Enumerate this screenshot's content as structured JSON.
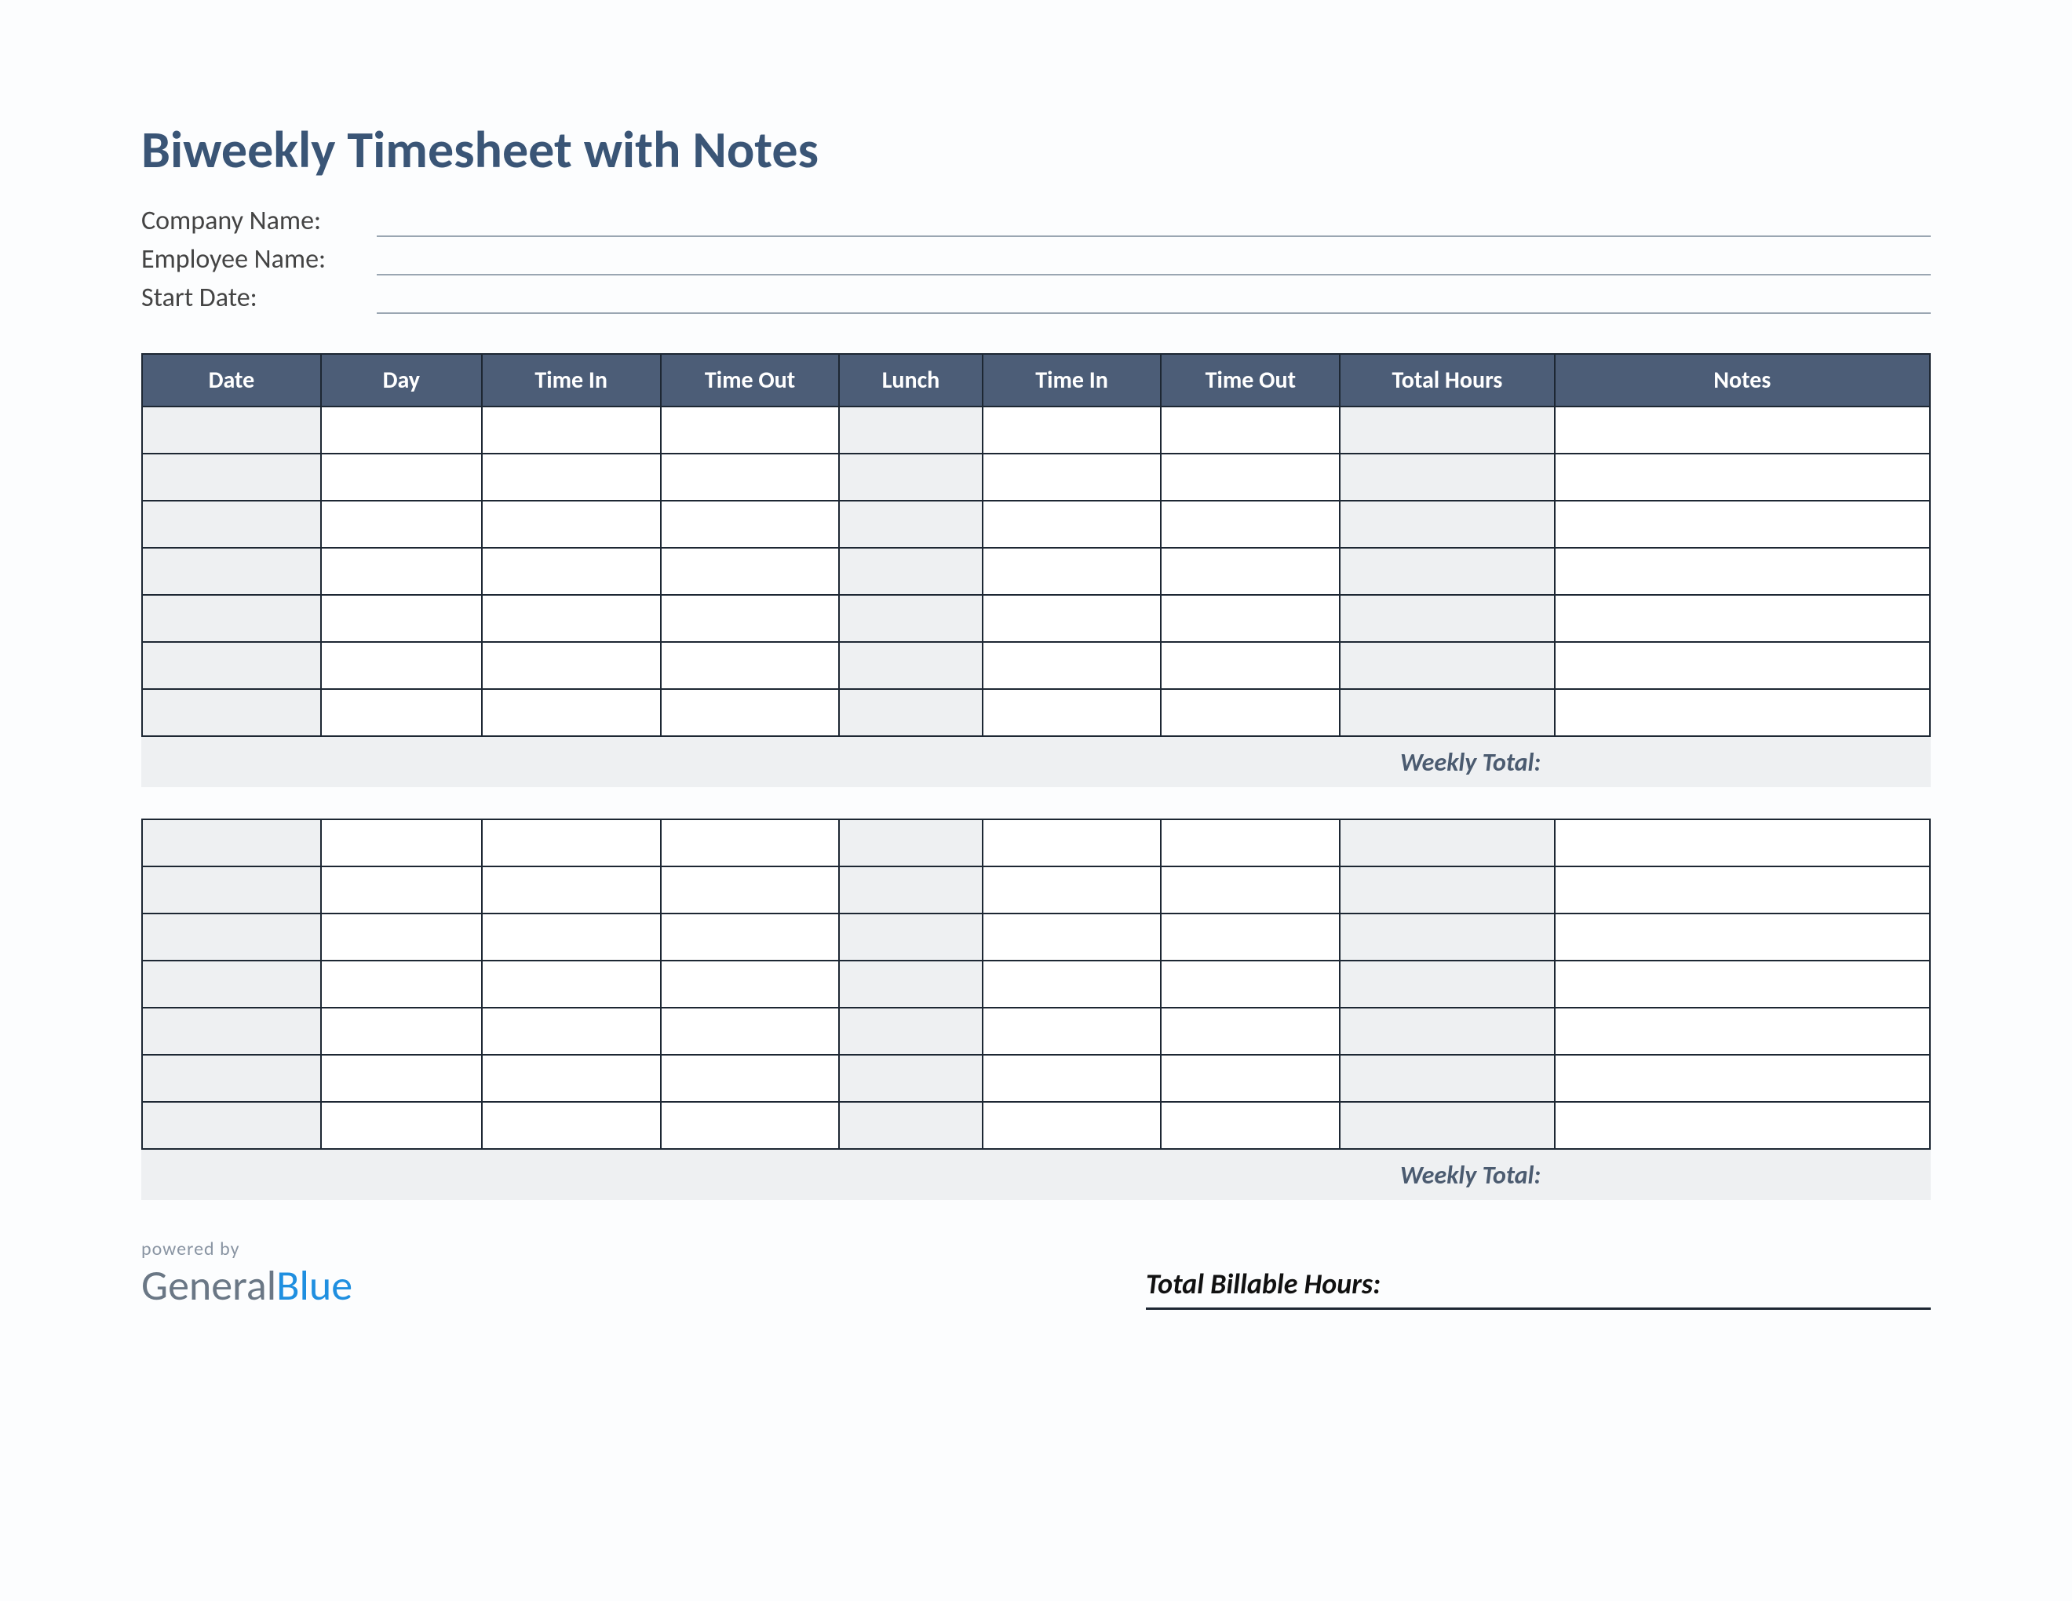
{
  "title": "Biweekly Timesheet with Notes",
  "fields": {
    "company": "Company Name:",
    "employee": "Employee Name:",
    "start_date": "Start Date:"
  },
  "columns": [
    "Date",
    "Day",
    "Time In",
    "Time Out",
    "Lunch",
    "Time In",
    "Time Out",
    "Total Hours",
    "Notes"
  ],
  "weekly_total_label": "Weekly Total:",
  "billable_label": "Total Billable Hours:",
  "brand": {
    "powered_by": "powered by",
    "part1": "General",
    "part2": "Blue"
  },
  "week_rows": 7
}
